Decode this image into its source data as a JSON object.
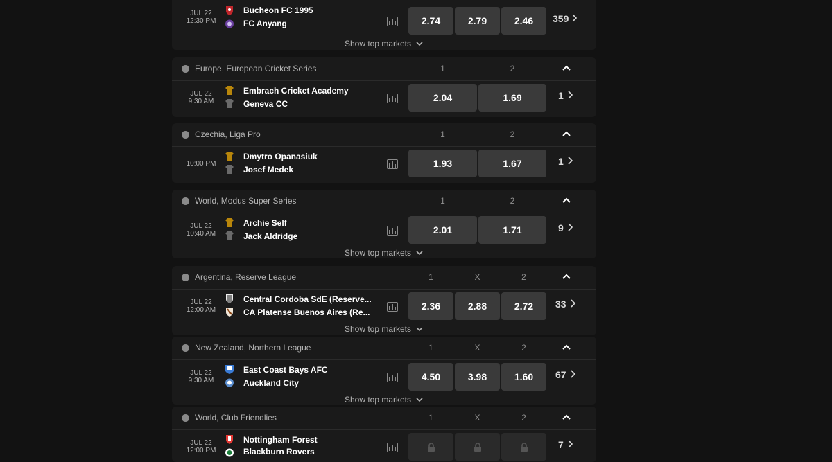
{
  "labels": {
    "show_top_markets": "Show top markets"
  },
  "cards": [
    {
      "event": {
        "date": "JUL 22",
        "time": "12:30 PM",
        "home": "Bucheon FC 1995",
        "away": "FC Anyang",
        "odds": [
          "2.74",
          "2.79",
          "2.46"
        ],
        "more": "359"
      }
    },
    {
      "league": "Europe, European Cricket Series",
      "cols": [
        "1",
        "2"
      ],
      "event": {
        "date": "JUL 22",
        "time": "9:30 AM",
        "home": "Embrach Cricket Academy",
        "away": "Geneva CC",
        "odds": [
          "2.04",
          "1.69"
        ],
        "more": "1"
      }
    },
    {
      "league": "Czechia, Liga Pro",
      "cols": [
        "1",
        "2"
      ],
      "event": {
        "date": "",
        "time": "10:00 PM",
        "home": "Dmytro Opanasiuk",
        "away": "Josef Medek",
        "odds": [
          "1.93",
          "1.67"
        ],
        "more": "1"
      }
    },
    {
      "league": "World, Modus Super Series",
      "cols": [
        "1",
        "2"
      ],
      "event": {
        "date": "JUL 22",
        "time": "10:40 AM",
        "home": "Archie Self",
        "away": "Jack Aldridge",
        "odds": [
          "2.01",
          "1.71"
        ],
        "more": "9"
      }
    },
    {
      "league": "Argentina, Reserve League",
      "cols": [
        "1",
        "X",
        "2"
      ],
      "event": {
        "date": "JUL 22",
        "time": "12:00 AM",
        "home": "Central Cordoba SdE (Reserve...",
        "away": "CA Platense Buenos Aires (Re...",
        "odds": [
          "2.36",
          "2.88",
          "2.72"
        ],
        "more": "33"
      }
    },
    {
      "league": "New Zealand, Northern League",
      "cols": [
        "1",
        "X",
        "2"
      ],
      "event": {
        "date": "JUL 22",
        "time": "9:30 AM",
        "home": "East Coast Bays AFC",
        "away": "Auckland City",
        "odds": [
          "4.50",
          "3.98",
          "1.60"
        ],
        "more": "67"
      }
    },
    {
      "league": "World, Club Friendlies",
      "cols": [
        "1",
        "X",
        "2"
      ],
      "event": {
        "date": "JUL 22",
        "time": "12:00 PM",
        "home": "Nottingham Forest",
        "away": "Blackburn Rovers",
        "odds": [
          "",
          "",
          ""
        ],
        "more": "7",
        "locked": true
      }
    }
  ],
  "colors": {
    "page_bg": "#121212",
    "card_bg": "#1a1a1a",
    "odds_bg": "#3a3a3a",
    "text_muted": "#b4b4b4"
  }
}
